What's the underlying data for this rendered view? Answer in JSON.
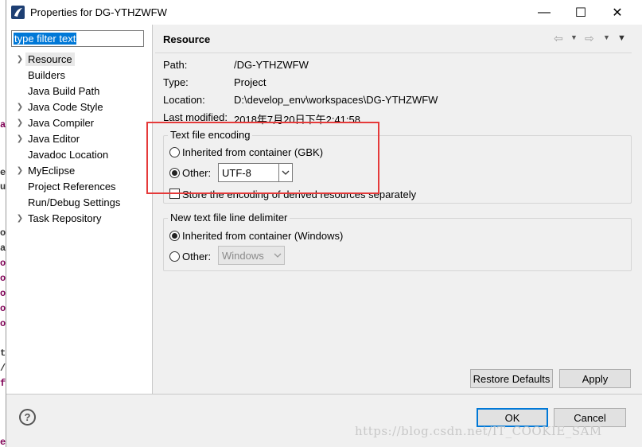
{
  "window": {
    "title": "Properties for DG-YTHZWFW",
    "minimize": "—",
    "maximize": "☐",
    "close": "✕"
  },
  "filter": {
    "value": "type filter text"
  },
  "tree": [
    {
      "label": "Resource",
      "expandable": true,
      "selected": true
    },
    {
      "label": "Builders",
      "expandable": false
    },
    {
      "label": "Java Build Path",
      "expandable": false
    },
    {
      "label": "Java Code Style",
      "expandable": true
    },
    {
      "label": "Java Compiler",
      "expandable": true
    },
    {
      "label": "Java Editor",
      "expandable": true
    },
    {
      "label": "Javadoc Location",
      "expandable": false
    },
    {
      "label": "MyEclipse",
      "expandable": true
    },
    {
      "label": "Project References",
      "expandable": false
    },
    {
      "label": "Run/Debug Settings",
      "expandable": false
    },
    {
      "label": "Task Repository",
      "expandable": true
    }
  ],
  "page": {
    "title": "Resource",
    "path_label": "Path:",
    "path_value": "/DG-YTHZWFW",
    "type_label": "Type:",
    "type_value": "Project",
    "location_label": "Location:",
    "location_value": "D:\\develop_env\\workspaces\\DG-YTHZWFW",
    "modified_label": "Last modified:",
    "modified_value": "2018年7月20日下午2:41:58"
  },
  "encoding": {
    "group_title": "Text file encoding",
    "inherited_label": "Inherited from container (GBK)",
    "other_label": "Other:",
    "other_value": "UTF-8",
    "store_label": "Store the encoding of derived resources separately"
  },
  "delimiter": {
    "group_title": "New text file line delimiter",
    "inherited_label": "Inherited from container (Windows)",
    "other_label": "Other:",
    "other_value": "Windows"
  },
  "buttons": {
    "restore": "Restore Defaults",
    "apply": "Apply",
    "ok": "OK",
    "cancel": "Cancel",
    "help": "?"
  },
  "watermark": "https://blog.csdn.net/IT_COOKIE_SAM",
  "colors": {
    "accent": "#0078d7",
    "highlight_box": "#e53a3a"
  }
}
